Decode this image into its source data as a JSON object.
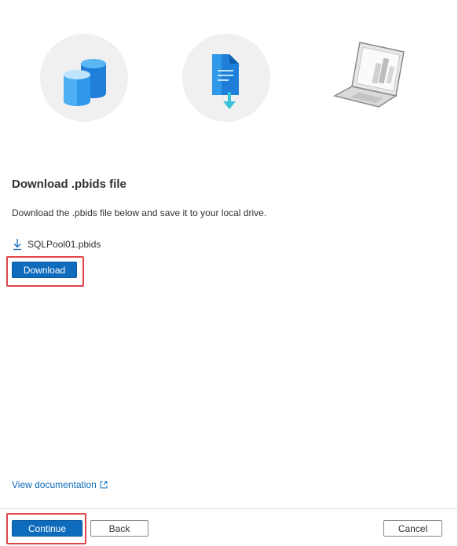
{
  "illustrations": [
    {
      "icon": "database-icon"
    },
    {
      "icon": "file-download-icon"
    },
    {
      "icon": "laptop-icon"
    }
  ],
  "section": {
    "title": "Download .pbids file",
    "description": "Download the .pbids file below and save it to your local drive."
  },
  "file": {
    "name": "SQLPool01.pbids",
    "icon": "download-arrow-icon"
  },
  "buttons": {
    "download": "Download",
    "continue": "Continue",
    "back": "Back",
    "cancel": "Cancel"
  },
  "links": {
    "documentation": "View documentation"
  },
  "colors": {
    "accent": "#0f6cbd",
    "highlight": "#e0454b"
  }
}
